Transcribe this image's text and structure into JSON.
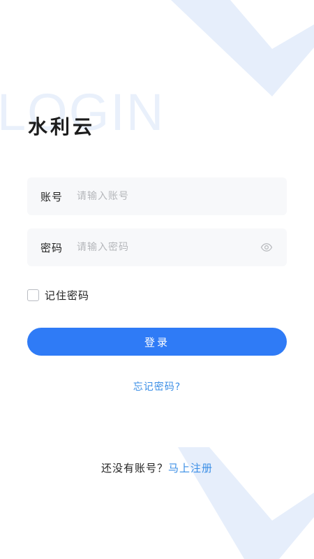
{
  "watermark": "LOGIN",
  "app_title": "水利云",
  "account": {
    "label": "账号",
    "placeholder": "请输入账号",
    "value": ""
  },
  "password": {
    "label": "密码",
    "placeholder": "请输入密码",
    "value": "",
    "toggle_icon": "eye-icon"
  },
  "remember": {
    "label": "记住密码",
    "checked": false
  },
  "login_button": "登录",
  "forgot_link": "忘记密码?",
  "register": {
    "prompt": "还没有账号？",
    "link": "马上注册"
  },
  "colors": {
    "accent": "#2f7bf6",
    "link": "#3a8ee6",
    "decoration": "#e9f0fb",
    "field_bg": "#f7f8fa"
  }
}
